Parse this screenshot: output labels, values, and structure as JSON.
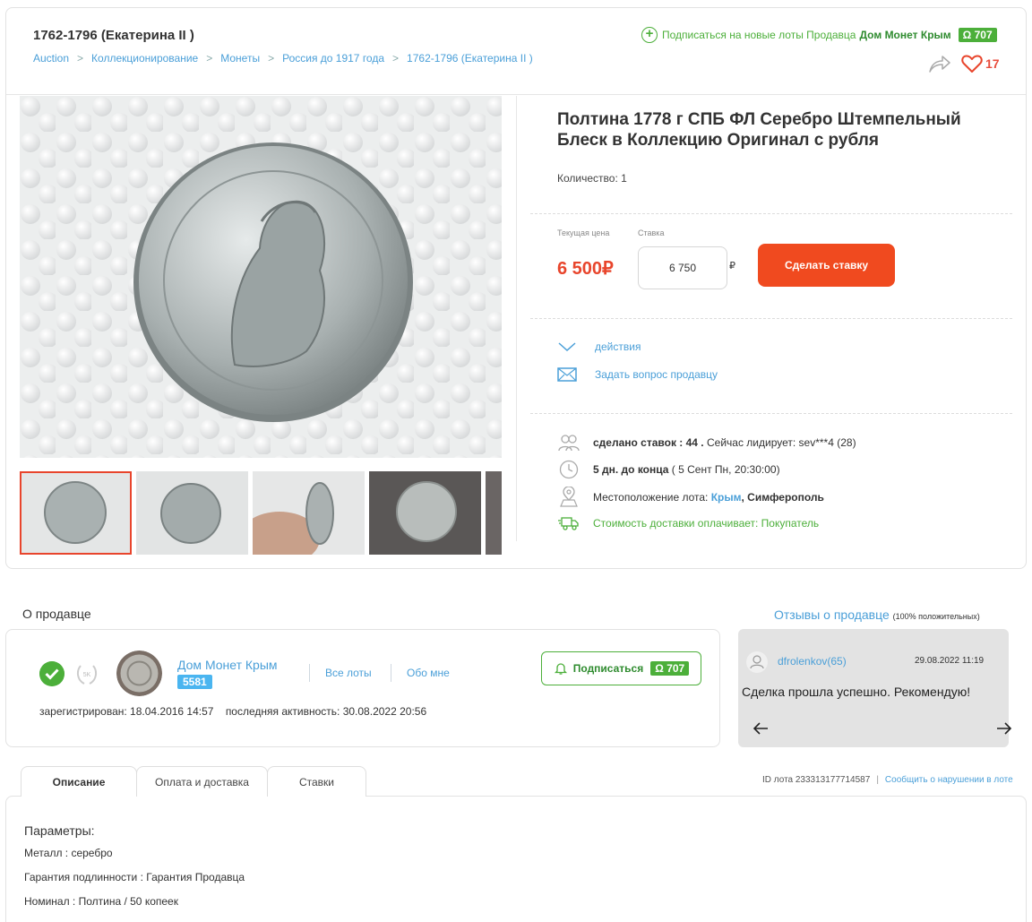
{
  "header": {
    "category_title": "1762-1796 (Екатерина II )",
    "breadcrumbs": [
      "Auction",
      "Коллекционирование",
      "Монеты",
      "Россия до 1917 года",
      "1762-1796 (Екатерина II )"
    ],
    "breadcrumb_separator": ">",
    "subscribe_text": "Подписаться на новые лоты Продавца",
    "seller_name": "Дом Монет Крым",
    "rating_symbol": "Ω",
    "rating_value": "707",
    "likes_count": "17"
  },
  "lot": {
    "title": "Полтина 1778 г СПБ ФЛ Серебро Штемпельный Блеск в Коллекцию Оригинал с рубля",
    "quantity": "Количество: 1",
    "current_price_label": "Текущая цена",
    "current_price": "6 500₽",
    "bid_label": "Ставка",
    "bid_value": "6 750",
    "bid_currency": "₽",
    "bid_button": "Сделать ставку",
    "actions_label": "действия",
    "ask_seller": "Задать вопрос продавцу",
    "bids_made_label": "сделано ставок : 44 .",
    "leader_text": "Сейчас лидирует: sev***4 (28)",
    "time_left": "5 дн. до конца",
    "end_date": "( 5 Сент Пн, 20:30:00)",
    "location_label": "Местоположение лота:",
    "location_region": "Крым",
    "location_city": ", Симферополь",
    "delivery_text": "Стоимость доставки оплачивает: Покупатель"
  },
  "seller": {
    "section_title": "О продавце",
    "name": "Дом Монет Крым",
    "rating": "5581",
    "wreath_label": "5K",
    "all_lots": "Все лоты",
    "about_me": "Обо мне",
    "subscribe_button": "Подписаться",
    "subscribe_rating": "707",
    "rating_symbol": "Ω",
    "registered": "зарегистрирован: 18.04.2016 14:57",
    "last_activity": "последняя активность: 30.08.2022 20:56"
  },
  "reviews": {
    "link_text": "Отзывы о продавце",
    "positive_note": "(100% положительных)",
    "reviewer": "dfrolenkov(65)",
    "date": "29.08.2022 11:19",
    "text": "Сделка прошла успешно. Рекомендую!"
  },
  "tabs": [
    "Описание",
    "Оплата и доставка",
    "Ставки"
  ],
  "lot_meta": {
    "lot_id": "ID лота 233313177714587",
    "separator": "|",
    "report_link": "Сообщить о нарушении в лоте"
  },
  "params": {
    "title": "Параметры:",
    "items": [
      "Металл : серебро",
      "Гарантия подлинности : Гарантия Продавца",
      "Номинал : Полтина / 50 копеек"
    ]
  },
  "colors": {
    "accent_orange": "#f04a1f",
    "price_red": "#e8452c",
    "link_blue": "#4a9fd8",
    "green": "#4caf3a"
  }
}
